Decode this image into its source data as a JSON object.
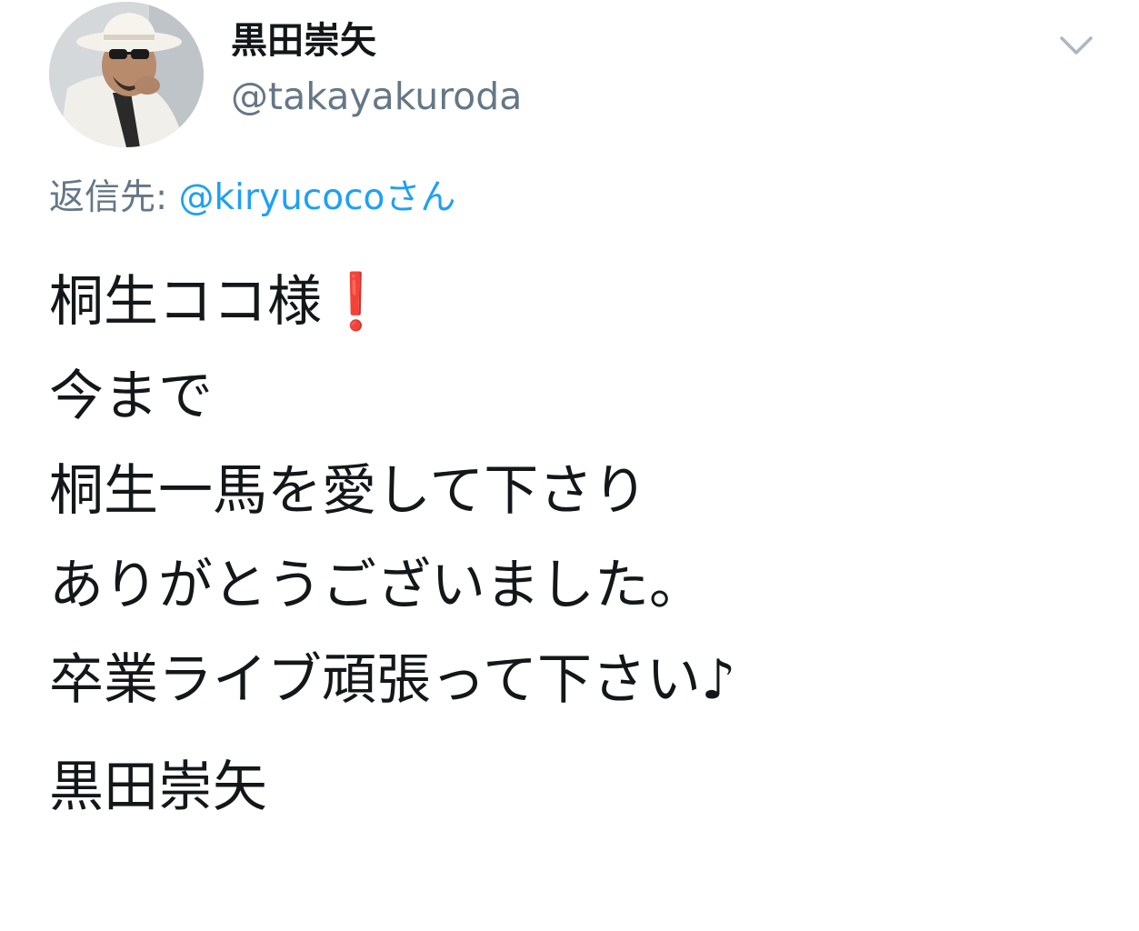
{
  "author": {
    "display_name": "黒田崇矢",
    "handle": "@takayakuroda",
    "avatar_icon": "user-photo-avatar"
  },
  "reply": {
    "prefix": "返信先: ",
    "mention": "@kiryucocoさん"
  },
  "more_icon": "chevron-down-icon",
  "colors": {
    "link": "#1da1f2",
    "muted": "#657786",
    "text": "#14171a",
    "emoji_red": "#e0141e"
  },
  "tweet": {
    "line1_text": "桐生ココ様",
    "line1_emoji": "❗",
    "line2": "今まで",
    "line3": "桐生一馬を愛して下さり",
    "line4": "ありがとうございました。",
    "line5": "卒業ライブ頑張って下さい♪",
    "signature": "黒田崇矢"
  }
}
